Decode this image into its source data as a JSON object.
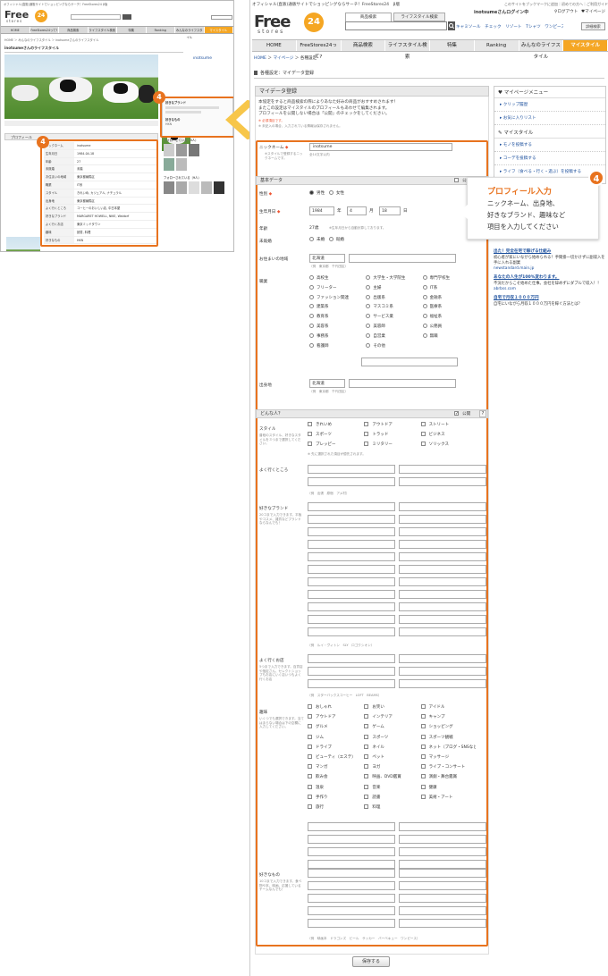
{
  "thumb": {
    "topbar": "オフィシャル(直販)通販サイトでショッピングならサーチ！FreeStores24 β版",
    "logo_main": "Free",
    "logo_sub": "stores",
    "logo_num": "24",
    "nav": [
      "HOME",
      "FreeStores24って?",
      "商品検索",
      "ライフスタイル検索",
      "特集",
      "Ranking",
      "みんなのライフスタイル",
      "マイスタイル"
    ],
    "breadcrumb": "HOME ＞ みんなのライフスタイル ＞ inotsumeさんのライフスタイル",
    "page_title": "inotsumeさんのライフスタイル",
    "user_name": "inotsume",
    "profile_header": "プロフィール",
    "fav_brand": "好きなブランド",
    "fav_thing": "好きなもの",
    "fav_value": "HKN",
    "follow_header": "フォローしている（3人）",
    "follower_header": "フォローされている（9人）",
    "badge": "4",
    "profile_rows": [
      [
        "ニックネーム",
        "inotsume"
      ],
      [
        "生年月日",
        "1984-04-18"
      ],
      [
        "年齢",
        "27"
      ],
      [
        "未既婚",
        "未婚"
      ],
      [
        "お住まいの地域",
        "東京都練馬区"
      ],
      [
        "職業",
        "IT系"
      ],
      [
        "スタイル",
        "きれいめ, カジュアル, ナチュラル"
      ],
      [
        "出身地",
        "東京都練馬区"
      ],
      [
        "よく行くところ",
        "コーヒーのおいしい店, 中古本屋"
      ],
      [
        "好きなブランド",
        "MARGARET HOWELL, NIKE, Waldorf"
      ],
      [
        "よく行くお店",
        "東京ミッドタウン"
      ],
      [
        "趣味",
        "読書, 料理"
      ],
      [
        "好きなもの",
        "HKN"
      ]
    ]
  },
  "main": {
    "topbar": "オフィシャル(直販)通販サイトでショッピングならサーチ！FreeStores24　β版",
    "topbar_right": "このサイトをブックマークに追加｜初めての方へ｜ご利用ガイド",
    "logo_main": "Free",
    "logo_sub": "stores",
    "logo_num": "24",
    "search_tab_product": "商品検索",
    "search_tab_lifestyle": "ライフスタイル検索",
    "search_keywords": "キャミソール　チェック　リゾート　Tシャツ　ワンピース",
    "search_button": "詳細検索",
    "user_status": "inotsumeさんログイン中",
    "logout": "ログアウト",
    "mypage": "マイページ",
    "nav": [
      "HOME",
      "FreeStores24って?",
      "商品検索",
      "ライフスタイル検索",
      "特集",
      "Ranking",
      "みんなのライフスタイル",
      "マイスタイル"
    ],
    "breadcrumb": [
      "HOME",
      "マイページ",
      "各種設定"
    ],
    "page_title": "各種設定：マイデータ登録",
    "form_title": "マイデータ登録",
    "intro": [
      "本協定をすると商品検索の際によりあなた好みの商品がおすすめされます！",
      "またこの設定はマイスタイルのプロフィールもあわせて編集されます。",
      "プロフィールを公開しない場合は「公開」のチェックをしてください。"
    ],
    "intro_notes": [
      "※ 必須項目です。",
      "※ 未記入の場合、入力されている情報は保存されません。"
    ],
    "nickname_label": "ニックネーム",
    "nickname_value": "inotsume",
    "nickname_help": "※スタイルで登録するニックネームです。",
    "nickname_limit": "全10文字以内",
    "basic_header": "基本データ",
    "public_label": "公開",
    "gender_label": "性別",
    "gender_options": [
      "男性",
      "女性"
    ],
    "birth_label": "生年月日",
    "birth_year": "1984",
    "birth_month": "4",
    "birth_day": "18",
    "year_unit": "年",
    "month_unit": "月",
    "day_unit": "日",
    "age_label": "年齢",
    "age_value": "27歳",
    "age_note": "※生年月日から自動計算しております。",
    "marital_label": "未既婚",
    "marital_options": [
      "未婚",
      "既婚"
    ],
    "area_label": "お住まいの地域",
    "area_pref": "北海道",
    "area_example": "（例　東京都　千代田区）",
    "job_label": "職業",
    "jobs": [
      "高校生",
      "大学生・大学院生",
      "専門学校生",
      "フリーター",
      "主婦",
      "IT系",
      "ファッション関連",
      "出版系",
      "金融系",
      "建築系",
      "マスコミ系",
      "医療系",
      "教育系",
      "サービス業",
      "福祉系",
      "美容系",
      "美容師",
      "公務員",
      "事務系",
      "自営業",
      "無職",
      "看護師",
      "その他"
    ],
    "hometown_label": "出身地",
    "hometown_pref": "北海道",
    "hometown_example": "（例　東京都　千代田区）",
    "how_header": "どんな人？",
    "style_label": "スタイル",
    "style_help": "普段のスタイル、好きなスタイルを３つまで選択してください。",
    "styles": [
      "きれいめ",
      "アウトドア",
      "ストリート",
      "スポーツ",
      "トラッド",
      "ビジネス",
      "プレッピー",
      "ミリタリー",
      "ソリックス"
    ],
    "style_note": "※ 先に選択された項目が優先されます。",
    "place_label": "よく行くところ",
    "place_example": "（例　出張　原宿　アメ村）",
    "brand_label": "好きなブランド",
    "brand_help": "20コまで入力できます。平板やコスメ、雑貨などブランドならなんでも！",
    "brand_example": "（例　ルイ・ヴィトン　SLY　ロゴクシオン）",
    "shop_label": "よく行くお店",
    "shop_help": "5つまで入力できます。百貨店や指定さん、セレクトショップもお店にいく店いつもよく行くお店",
    "shop_example": "（例　スターバックスコーヒー　LOFT　BEAMS）",
    "hobby_label": "趣味",
    "hobby_help": "いくつでも選択できます。当てはまらない場合は下の空欄に入力してください。",
    "hobbies": [
      "おしゃれ",
      "お笑い",
      "アイドル",
      "アウトドア",
      "インテリア",
      "キャンプ",
      "グルメ",
      "ゲーム",
      "ショッピング",
      "ジム",
      "スポーツ",
      "スポーツ観戦",
      "ドライブ",
      "ネイル",
      "ネット（ブログ・SNSなど）",
      "ビューティ（エステ）",
      "ペット",
      "マッサージ",
      "マンガ",
      "ヨガ",
      "ライブ・コンサート",
      "飲み会",
      "映画、DVD鑑賞",
      "演劇・舞台鑑賞",
      "温泉",
      "音楽",
      "健康",
      "手作り",
      "読書",
      "美術・アート",
      "旅行",
      "料理"
    ],
    "fav_label": "好きなもの",
    "fav_help": "10コまで入力できます。食べ物や本、映画、応援しているチームなんでも！",
    "fav_example": "（例　映画本　ドラゴンズ　ビール　サッカー　バーベキュー　ワンピース）",
    "save_button": "保存する"
  },
  "side": {
    "menu_header": "マイページメニュー",
    "menu_items": [
      "クリップ履歴",
      "お気に入りリスト"
    ],
    "mystyle_header": "マイスタイル",
    "mystyle_items": [
      "モノを投稿する",
      "コーデを投稿する",
      "ライフ（食べる・行く・遊ぶ）を投稿する"
    ],
    "ads": [
      {
        "title": "出た！完全在宅で稼げる仕組み",
        "body": "初心者が家にいながら始められる！手間掛一切かけずに副収入を手に入れる副業",
        "url": "newstandard.main.jp"
      },
      {
        "title": "あなたの人生が100%変わります。",
        "body": "不況だからこそ始めた仕事。会社を辞めずにダブルで収入！！",
        "url": "abrbss.com"
      },
      {
        "title": "自宅で月収１０００万円",
        "body": "自宅にいながら月収１０００万円を稼ぐ方法とは？",
        "url": ""
      }
    ]
  },
  "callout": {
    "badge": "4",
    "title": "プロフィール入力",
    "body": [
      "ニックネーム、出身地、",
      "好きなブランド、趣味など",
      "項目を入力してください"
    ]
  },
  "colors": {
    "accent": "#e8731f",
    "nav_active": "#f5a623",
    "link": "#1a4e9c",
    "callout_title": "#e8731f"
  }
}
